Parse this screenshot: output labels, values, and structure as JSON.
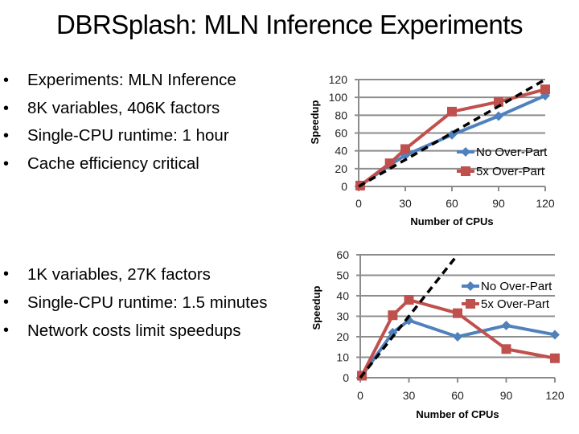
{
  "slide": {
    "title": "DBRSplash:  MLN Inference Experiments",
    "bullets_top": [
      "Experiments:  MLN Inference",
      "8K variables, 406K factors",
      "Single-CPU runtime:   1 hour",
      "Cache efficiency critical"
    ],
    "bullets_bottom": [
      "1K variables, 27K factors",
      "Single-CPU runtime:  1.5 minutes",
      "Network costs limit speedups"
    ]
  },
  "colors": {
    "no_over_part": "#4f81bd",
    "five_x_over_part": "#c0504d",
    "ideal": "#000000",
    "grid": "#8c8c8c"
  },
  "chart_data": [
    {
      "type": "line",
      "title": "",
      "xlabel": "Number of CPUs",
      "ylabel": "Speedup",
      "xlim": [
        0,
        120
      ],
      "ylim": [
        0,
        120
      ],
      "xticks": [
        0,
        30,
        60,
        90,
        120
      ],
      "yticks": [
        0,
        20,
        40,
        60,
        80,
        100,
        120
      ],
      "grid": true,
      "legend": "right-middle",
      "series": [
        {
          "name": "No Over-Part",
          "x": [
            1,
            20,
            30,
            60,
            90,
            120
          ],
          "y": [
            1,
            24,
            35,
            58,
            79,
            102
          ],
          "marker": "diamond",
          "color_key": "no_over_part"
        },
        {
          "name": "5x Over-Part",
          "x": [
            1,
            20,
            30,
            60,
            90,
            120
          ],
          "y": [
            1,
            26,
            42,
            84,
            95,
            109
          ],
          "marker": "square",
          "color_key": "five_x_over_part"
        }
      ],
      "ideal_line": {
        "x": [
          0,
          120
        ],
        "y": [
          0,
          120
        ],
        "style": "dashed"
      }
    },
    {
      "type": "line",
      "title": "",
      "xlabel": "Number of CPUs",
      "ylabel": "Speedup",
      "xlim": [
        0,
        120
      ],
      "ylim": [
        0,
        60
      ],
      "xticks": [
        0,
        30,
        60,
        90,
        120
      ],
      "yticks": [
        0,
        10,
        20,
        30,
        40,
        50,
        60
      ],
      "grid": true,
      "legend": "top-right",
      "series": [
        {
          "name": "No Over-Part",
          "x": [
            1,
            20,
            30,
            60,
            90,
            120
          ],
          "y": [
            1,
            22,
            28,
            20,
            25.5,
            21
          ],
          "marker": "diamond",
          "color_key": "no_over_part"
        },
        {
          "name": "5x Over-Part",
          "x": [
            1,
            20,
            30,
            60,
            90,
            120
          ],
          "y": [
            1,
            30.5,
            38,
            31.5,
            14,
            9.5
          ],
          "marker": "square",
          "color_key": "five_x_over_part"
        }
      ],
      "ideal_line": {
        "x": [
          0,
          60
        ],
        "y": [
          0,
          60
        ],
        "style": "dashed"
      }
    }
  ]
}
